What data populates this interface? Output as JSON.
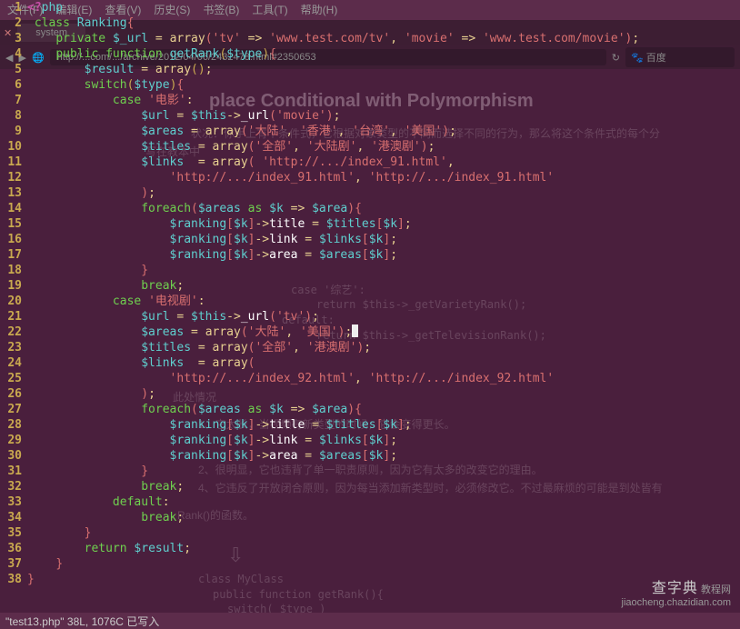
{
  "menubar": [
    "文件(F)",
    "编辑(E)",
    "查看(V)",
    "历史(S)",
    "书签(B)",
    "工具(T)",
    "帮助(H)"
  ],
  "tab_label": "system",
  "url": "http://...com/.../archive/2012/04/06/2432478.html#2350653",
  "search_engine": "百度",
  "ghost_heading": "place Conditional with Polymorphism",
  "ghost_lines": {
    "a": "状况：你手上有个条件式，它根据对象类型的不同而选择不同的行为，那么将这个条件式的每个分",
    "b": "写在教本中",
    "c": "1、它太长，当视频有新类型的时候，它会变得更长。",
    "d": "2、很明显，它也违背了单一职责原则，因为它有太多的改变它的理由。",
    "e": "4、它违反了开放闭合原则，因为每当添加新类型时，必须修改它。不过最麻烦的可能是到处皆有",
    "f": "Rank()的函数。",
    "g": "此处情况",
    "h": "class MyClass",
    "i": "public function getRank(){",
    "j": "switch( $type )",
    "k": "case '综艺':",
    "l": "return $this->_getVarietyRank();",
    "m": "default:",
    "n": "return $this->_getTelevisionRank();"
  },
  "code": [
    {
      "n": 1,
      "t": [
        [
          "kw",
          "<?"
        ],
        [
          "fn",
          "php"
        ]
      ]
    },
    {
      "n": 2,
      "t": [
        [
          "w",
          " "
        ],
        [
          "k",
          "class"
        ],
        [
          "w",
          " "
        ],
        [
          "fn",
          "Ranking"
        ],
        [
          "br",
          "{"
        ]
      ]
    },
    {
      "n": 3,
      "t": [
        [
          "w",
          "    "
        ],
        [
          "k",
          "private"
        ],
        [
          "w",
          " "
        ],
        [
          "v",
          "$_url"
        ],
        [
          "w",
          " "
        ],
        [
          "p",
          "="
        ],
        [
          "w",
          " "
        ],
        [
          "arr",
          "array"
        ],
        [
          "br",
          "("
        ],
        [
          "s",
          "'tv'"
        ],
        [
          "w",
          " "
        ],
        [
          "p",
          "=>"
        ],
        [
          "w",
          " "
        ],
        [
          "s",
          "'www.test.com/tv'"
        ],
        [
          "p",
          ","
        ],
        [
          "w",
          " "
        ],
        [
          "s",
          "'movie'"
        ],
        [
          "w",
          " "
        ],
        [
          "p",
          "=>"
        ],
        [
          "w",
          " "
        ],
        [
          "s",
          "'www.test.com/movie'"
        ],
        [
          "br",
          ")"
        ],
        [
          "p",
          ";"
        ]
      ]
    },
    {
      "n": 4,
      "t": [
        [
          "w",
          "    "
        ],
        [
          "k",
          "public"
        ],
        [
          "w",
          " "
        ],
        [
          "k",
          "function"
        ],
        [
          "w",
          " "
        ],
        [
          "fn",
          "getRank"
        ],
        [
          "br2",
          "("
        ],
        [
          "v",
          "$type"
        ],
        [
          "br2",
          ")"
        ],
        [
          "br",
          "{"
        ]
      ]
    },
    {
      "n": 5,
      "t": [
        [
          "w",
          "        "
        ],
        [
          "v",
          "$result"
        ],
        [
          "w",
          " "
        ],
        [
          "p",
          "="
        ],
        [
          "w",
          " "
        ],
        [
          "arr",
          "array"
        ],
        [
          "br2",
          "()"
        ],
        [
          "p",
          ";"
        ]
      ]
    },
    {
      "n": 6,
      "t": [
        [
          "w",
          "        "
        ],
        [
          "k",
          "switch"
        ],
        [
          "br2",
          "("
        ],
        [
          "v",
          "$type"
        ],
        [
          "br2",
          ")"
        ],
        [
          "br",
          "{"
        ]
      ]
    },
    {
      "n": 7,
      "t": [
        [
          "w",
          "            "
        ],
        [
          "k",
          "case"
        ],
        [
          "w",
          " "
        ],
        [
          "s",
          "'电影'"
        ],
        [
          "p",
          ":"
        ]
      ]
    },
    {
      "n": 8,
      "t": [
        [
          "w",
          "                "
        ],
        [
          "v",
          "$url"
        ],
        [
          "w",
          " "
        ],
        [
          "p",
          "="
        ],
        [
          "w",
          " "
        ],
        [
          "v",
          "$this"
        ],
        [
          "p",
          "->"
        ],
        [
          "w",
          "_url"
        ],
        [
          "br",
          "("
        ],
        [
          "s",
          "'movie'"
        ],
        [
          "br",
          ")"
        ],
        [
          "p",
          ";"
        ]
      ]
    },
    {
      "n": 9,
      "t": [
        [
          "w",
          "                "
        ],
        [
          "v",
          "$areas"
        ],
        [
          "w",
          " "
        ],
        [
          "p",
          "="
        ],
        [
          "w",
          " "
        ],
        [
          "arr",
          "array"
        ],
        [
          "br",
          "("
        ],
        [
          "s",
          "'大陆'"
        ],
        [
          "p",
          ","
        ],
        [
          "w",
          " "
        ],
        [
          "s",
          "'香港'"
        ],
        [
          "p",
          ","
        ],
        [
          "w",
          " "
        ],
        [
          "s",
          "'台湾'"
        ],
        [
          "p",
          ","
        ],
        [
          "w",
          " "
        ],
        [
          "s",
          "'美国'"
        ],
        [
          "br",
          ")"
        ],
        [
          "p",
          ";"
        ]
      ]
    },
    {
      "n": 10,
      "t": [
        [
          "w",
          "                "
        ],
        [
          "v",
          "$titles"
        ],
        [
          "w",
          " "
        ],
        [
          "p",
          "="
        ],
        [
          "w",
          " "
        ],
        [
          "arr",
          "array"
        ],
        [
          "br",
          "("
        ],
        [
          "s",
          "'全部'"
        ],
        [
          "p",
          ","
        ],
        [
          "w",
          " "
        ],
        [
          "s",
          "'大陆剧'"
        ],
        [
          "p",
          ","
        ],
        [
          "w",
          " "
        ],
        [
          "s",
          "'港澳剧'"
        ],
        [
          "br",
          ")"
        ],
        [
          "p",
          ";"
        ]
      ]
    },
    {
      "n": 11,
      "t": [
        [
          "w",
          "                "
        ],
        [
          "v",
          "$links"
        ],
        [
          "w",
          "  "
        ],
        [
          "p",
          "="
        ],
        [
          "w",
          " "
        ],
        [
          "arr",
          "array"
        ],
        [
          "br",
          "("
        ],
        [
          "w",
          " "
        ],
        [
          "s",
          "'http://.../index_91.html'"
        ],
        [
          "p",
          ","
        ]
      ]
    },
    {
      "n": 12,
      "t": [
        [
          "w",
          "                    "
        ],
        [
          "s",
          "'http://.../index_91.html'"
        ],
        [
          "p",
          ","
        ],
        [
          "w",
          " "
        ],
        [
          "s",
          "'http://.../index_91.html'"
        ]
      ]
    },
    {
      "n": 13,
      "t": [
        [
          "w",
          "                "
        ],
        [
          "br",
          ")"
        ],
        [
          "p",
          ";"
        ]
      ]
    },
    {
      "n": 14,
      "t": [
        [
          "w",
          "                "
        ],
        [
          "k",
          "foreach"
        ],
        [
          "br",
          "("
        ],
        [
          "v",
          "$areas"
        ],
        [
          "w",
          " "
        ],
        [
          "k",
          "as"
        ],
        [
          "w",
          " "
        ],
        [
          "v",
          "$k"
        ],
        [
          "w",
          " "
        ],
        [
          "p",
          "=>"
        ],
        [
          "w",
          " "
        ],
        [
          "v",
          "$area"
        ],
        [
          "br",
          ")"
        ],
        [
          "br",
          "{"
        ]
      ]
    },
    {
      "n": 15,
      "t": [
        [
          "w",
          "                    "
        ],
        [
          "v",
          "$ranking"
        ],
        [
          "br",
          "["
        ],
        [
          "v",
          "$k"
        ],
        [
          "br",
          "]"
        ],
        [
          "p",
          "->"
        ],
        [
          "w",
          "title "
        ],
        [
          "p",
          "="
        ],
        [
          "w",
          " "
        ],
        [
          "v",
          "$titles"
        ],
        [
          "br",
          "["
        ],
        [
          "v",
          "$k"
        ],
        [
          "br",
          "]"
        ],
        [
          "p",
          ";"
        ]
      ]
    },
    {
      "n": 16,
      "t": [
        [
          "w",
          "                    "
        ],
        [
          "v",
          "$ranking"
        ],
        [
          "br",
          "["
        ],
        [
          "v",
          "$k"
        ],
        [
          "br",
          "]"
        ],
        [
          "p",
          "->"
        ],
        [
          "w",
          "link "
        ],
        [
          "p",
          "="
        ],
        [
          "w",
          " "
        ],
        [
          "v",
          "$links"
        ],
        [
          "br",
          "["
        ],
        [
          "v",
          "$k"
        ],
        [
          "br",
          "]"
        ],
        [
          "p",
          ";"
        ]
      ]
    },
    {
      "n": 17,
      "t": [
        [
          "w",
          "                    "
        ],
        [
          "v",
          "$ranking"
        ],
        [
          "br",
          "["
        ],
        [
          "v",
          "$k"
        ],
        [
          "br",
          "]"
        ],
        [
          "p",
          "->"
        ],
        [
          "w",
          "area "
        ],
        [
          "p",
          "="
        ],
        [
          "w",
          " "
        ],
        [
          "v",
          "$areas"
        ],
        [
          "br",
          "["
        ],
        [
          "v",
          "$k"
        ],
        [
          "br",
          "]"
        ],
        [
          "p",
          ";"
        ]
      ]
    },
    {
      "n": 18,
      "t": [
        [
          "w",
          "                "
        ],
        [
          "br",
          "}"
        ]
      ]
    },
    {
      "n": 19,
      "t": [
        [
          "w",
          "                "
        ],
        [
          "k",
          "break"
        ],
        [
          "p",
          ";"
        ]
      ]
    },
    {
      "n": 20,
      "t": [
        [
          "w",
          "            "
        ],
        [
          "k",
          "case"
        ],
        [
          "w",
          " "
        ],
        [
          "s",
          "'电视剧'"
        ],
        [
          "p",
          ":"
        ]
      ]
    },
    {
      "n": 21,
      "t": [
        [
          "w",
          "                "
        ],
        [
          "v",
          "$url"
        ],
        [
          "w",
          " "
        ],
        [
          "p",
          "="
        ],
        [
          "w",
          " "
        ],
        [
          "v",
          "$this"
        ],
        [
          "p",
          "->"
        ],
        [
          "w",
          "_url"
        ],
        [
          "br",
          "("
        ],
        [
          "s",
          "'tv'"
        ],
        [
          "br",
          ")"
        ],
        [
          "p",
          ";"
        ]
      ]
    },
    {
      "n": 22,
      "t": [
        [
          "w",
          "                "
        ],
        [
          "v",
          "$areas"
        ],
        [
          "w",
          " "
        ],
        [
          "p",
          "="
        ],
        [
          "w",
          " "
        ],
        [
          "arr",
          "array"
        ],
        [
          "br",
          "("
        ],
        [
          "s",
          "'大陆'"
        ],
        [
          "p",
          ","
        ],
        [
          "w",
          " "
        ],
        [
          "s",
          "'美国'"
        ],
        [
          "br",
          ")"
        ],
        [
          "p",
          ";"
        ],
        [
          "cursor",
          ""
        ]
      ]
    },
    {
      "n": 23,
      "t": [
        [
          "w",
          "                "
        ],
        [
          "v",
          "$titles"
        ],
        [
          "w",
          " "
        ],
        [
          "p",
          "="
        ],
        [
          "w",
          " "
        ],
        [
          "arr",
          "array"
        ],
        [
          "br",
          "("
        ],
        [
          "s",
          "'全部'"
        ],
        [
          "p",
          ","
        ],
        [
          "w",
          " "
        ],
        [
          "s",
          "'港澳剧'"
        ],
        [
          "br",
          ")"
        ],
        [
          "p",
          ";"
        ]
      ]
    },
    {
      "n": 24,
      "t": [
        [
          "w",
          "                "
        ],
        [
          "v",
          "$links"
        ],
        [
          "w",
          "  "
        ],
        [
          "p",
          "="
        ],
        [
          "w",
          " "
        ],
        [
          "arr",
          "array"
        ],
        [
          "br",
          "("
        ]
      ]
    },
    {
      "n": 25,
      "t": [
        [
          "w",
          "                    "
        ],
        [
          "s",
          "'http://.../index_92.html'"
        ],
        [
          "p",
          ","
        ],
        [
          "w",
          " "
        ],
        [
          "s",
          "'http://.../index_92.html'"
        ]
      ]
    },
    {
      "n": 26,
      "t": [
        [
          "w",
          "                "
        ],
        [
          "br",
          ")"
        ],
        [
          "p",
          ";"
        ]
      ]
    },
    {
      "n": 27,
      "t": [
        [
          "w",
          "                "
        ],
        [
          "k",
          "foreach"
        ],
        [
          "br",
          "("
        ],
        [
          "v",
          "$areas"
        ],
        [
          "w",
          " "
        ],
        [
          "k",
          "as"
        ],
        [
          "w",
          " "
        ],
        [
          "v",
          "$k"
        ],
        [
          "w",
          " "
        ],
        [
          "p",
          "=>"
        ],
        [
          "w",
          " "
        ],
        [
          "v",
          "$area"
        ],
        [
          "br",
          ")"
        ],
        [
          "br",
          "{"
        ]
      ]
    },
    {
      "n": 28,
      "t": [
        [
          "w",
          "                    "
        ],
        [
          "v",
          "$ranking"
        ],
        [
          "br",
          "["
        ],
        [
          "v",
          "$k"
        ],
        [
          "br",
          "]"
        ],
        [
          "p",
          "->"
        ],
        [
          "w",
          "title "
        ],
        [
          "p",
          "="
        ],
        [
          "w",
          " "
        ],
        [
          "v",
          "$titles"
        ],
        [
          "br",
          "["
        ],
        [
          "v",
          "$k"
        ],
        [
          "br",
          "]"
        ],
        [
          "p",
          ";"
        ]
      ]
    },
    {
      "n": 29,
      "t": [
        [
          "w",
          "                    "
        ],
        [
          "v",
          "$ranking"
        ],
        [
          "br",
          "["
        ],
        [
          "v",
          "$k"
        ],
        [
          "br",
          "]"
        ],
        [
          "p",
          "->"
        ],
        [
          "w",
          "link "
        ],
        [
          "p",
          "="
        ],
        [
          "w",
          " "
        ],
        [
          "v",
          "$links"
        ],
        [
          "br",
          "["
        ],
        [
          "v",
          "$k"
        ],
        [
          "br",
          "]"
        ],
        [
          "p",
          ";"
        ]
      ]
    },
    {
      "n": 30,
      "t": [
        [
          "w",
          "                    "
        ],
        [
          "v",
          "$ranking"
        ],
        [
          "br",
          "["
        ],
        [
          "v",
          "$k"
        ],
        [
          "br",
          "]"
        ],
        [
          "p",
          "->"
        ],
        [
          "w",
          "area "
        ],
        [
          "p",
          "="
        ],
        [
          "w",
          " "
        ],
        [
          "v",
          "$areas"
        ],
        [
          "br",
          "["
        ],
        [
          "v",
          "$k"
        ],
        [
          "br",
          "]"
        ],
        [
          "p",
          ";"
        ]
      ]
    },
    {
      "n": 31,
      "t": [
        [
          "w",
          "                "
        ],
        [
          "br",
          "}"
        ]
      ]
    },
    {
      "n": 32,
      "t": [
        [
          "w",
          "                "
        ],
        [
          "k",
          "break"
        ],
        [
          "p",
          ";"
        ]
      ]
    },
    {
      "n": 33,
      "t": [
        [
          "w",
          "            "
        ],
        [
          "k",
          "default"
        ],
        [
          "p",
          ":"
        ]
      ]
    },
    {
      "n": 34,
      "t": [
        [
          "w",
          "                "
        ],
        [
          "k",
          "break"
        ],
        [
          "p",
          ";"
        ]
      ]
    },
    {
      "n": 35,
      "t": [
        [
          "w",
          "        "
        ],
        [
          "br",
          "}"
        ]
      ]
    },
    {
      "n": 36,
      "t": [
        [
          "w",
          "        "
        ],
        [
          "k",
          "return"
        ],
        [
          "w",
          " "
        ],
        [
          "v",
          "$result"
        ],
        [
          "p",
          ";"
        ]
      ]
    },
    {
      "n": 37,
      "t": [
        [
          "w",
          "    "
        ],
        [
          "br",
          "}"
        ]
      ]
    },
    {
      "n": 38,
      "t": [
        [
          "br",
          "}"
        ]
      ]
    }
  ],
  "status": "\"test13.php\" 38L, 1076C 已写入",
  "watermark_main": "查字典",
  "watermark_sub1": "教程网",
  "watermark_sub2": "jiaocheng.chazidian.com"
}
